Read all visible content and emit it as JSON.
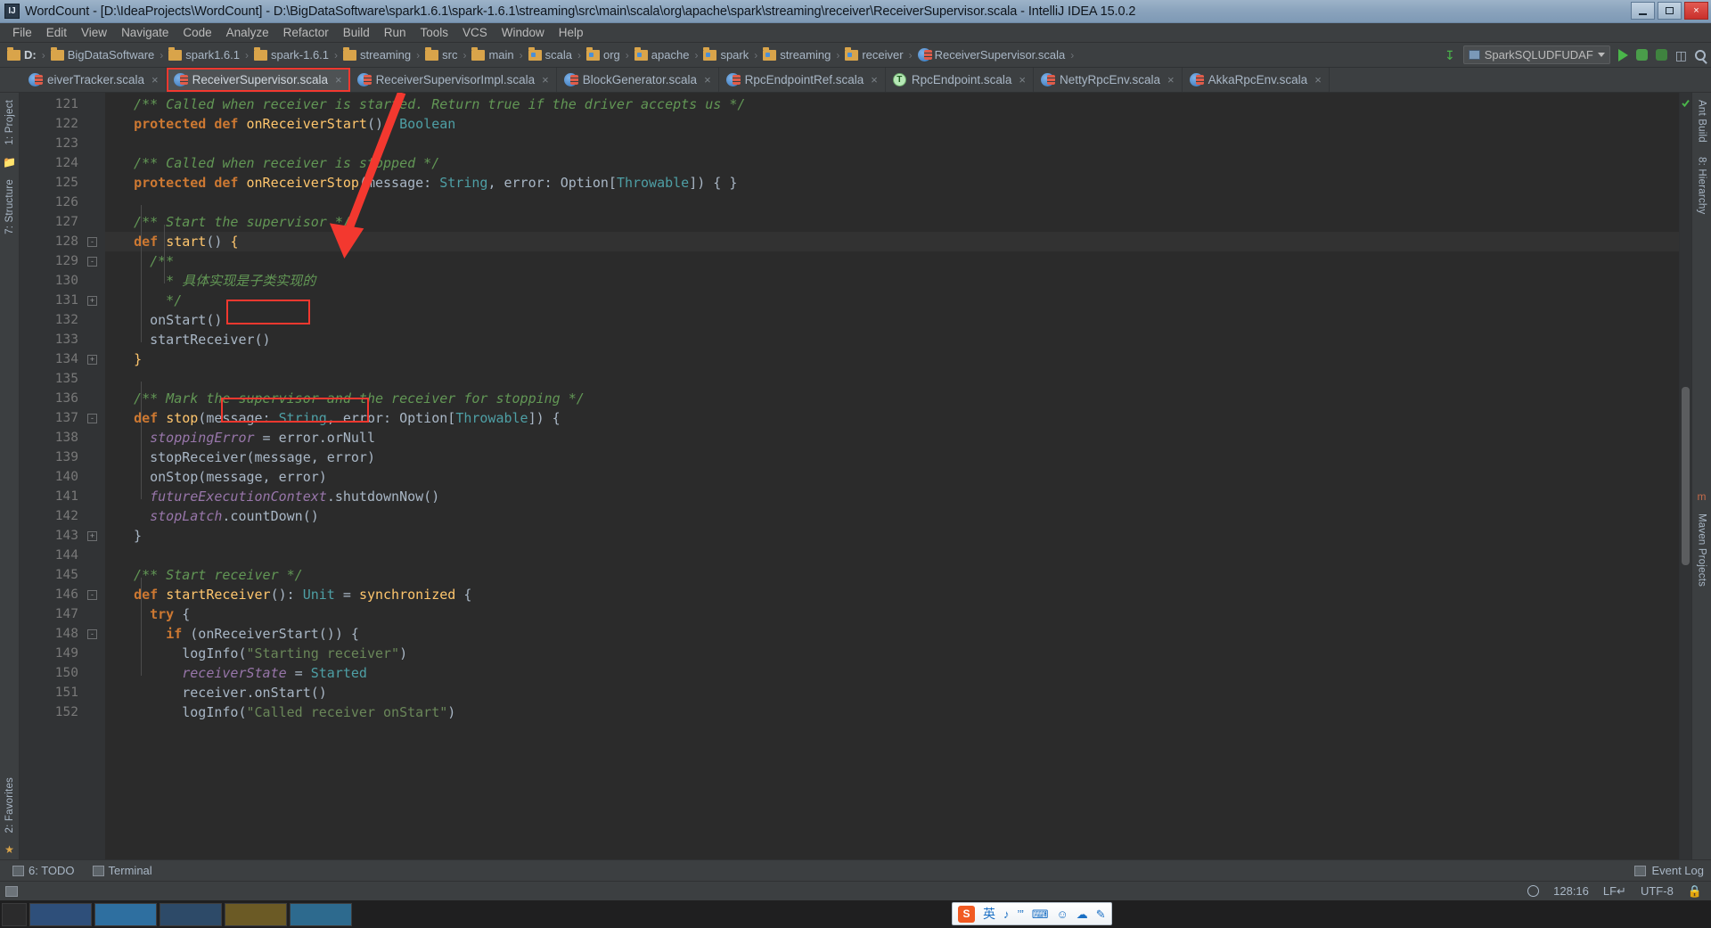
{
  "window": {
    "title": "WordCount - [D:\\IdeaProjects\\WordCount] - D:\\BigDataSoftware\\spark1.6.1\\spark-1.6.1\\streaming\\src\\main\\scala\\org\\apache\\spark\\streaming\\receiver\\ReceiverSupervisor.scala - IntelliJ IDEA 15.0.2",
    "app_icon": "IJ",
    "buttons": {
      "minimize": "minimize-icon",
      "maximize": "maximize-icon",
      "close": "×"
    }
  },
  "menubar": {
    "items": [
      "File",
      "Edit",
      "View",
      "Navigate",
      "Code",
      "Analyze",
      "Refactor",
      "Build",
      "Run",
      "Tools",
      "VCS",
      "Window",
      "Help"
    ]
  },
  "breadcrumb": {
    "items": [
      {
        "label": "D:",
        "icon": "folder-icon",
        "bold": true
      },
      {
        "label": "BigDataSoftware",
        "icon": "folder-icon",
        "bold": false
      },
      {
        "label": "spark1.6.1",
        "icon": "folder-icon",
        "bold": false
      },
      {
        "label": "spark-1.6.1",
        "icon": "folder-icon",
        "bold": false
      },
      {
        "label": "streaming",
        "icon": "folder-icon",
        "bold": false
      },
      {
        "label": "src",
        "icon": "folder-icon",
        "bold": false
      },
      {
        "label": "main",
        "icon": "folder-icon",
        "bold": false
      },
      {
        "label": "scala",
        "icon": "source-folder-icon",
        "bold": false
      },
      {
        "label": "org",
        "icon": "source-folder-icon",
        "bold": false
      },
      {
        "label": "apache",
        "icon": "source-folder-icon",
        "bold": false
      },
      {
        "label": "spark",
        "icon": "source-folder-icon",
        "bold": false
      },
      {
        "label": "streaming",
        "icon": "source-folder-icon",
        "bold": false
      },
      {
        "label": "receiver",
        "icon": "source-folder-icon",
        "bold": false
      },
      {
        "label": "ReceiverSupervisor.scala",
        "icon": "scala-file-icon",
        "bold": false
      }
    ]
  },
  "toolbar_right": {
    "sync_icon": "update-project-icon",
    "run_config": {
      "name": "SparkSQLUDFUDAF",
      "icon": "config-icon",
      "dropdown": "chevron-down-icon"
    },
    "run_icon": "run-icon",
    "debug_icon": "debug-icon",
    "coverage_icon": "run-with-coverage-icon",
    "layout_icon": "project-structure-icon",
    "search_icon": "search-everywhere-icon"
  },
  "tabs": [
    {
      "label": "eiverTracker.scala",
      "icon": "scala-file-icon",
      "active": false,
      "highlighted": false,
      "close": "×"
    },
    {
      "label": "ReceiverSupervisor.scala",
      "icon": "scala-file-icon",
      "active": true,
      "highlighted": true,
      "close": "×"
    },
    {
      "label": "ReceiverSupervisorImpl.scala",
      "icon": "scala-file-icon",
      "active": false,
      "highlighted": false,
      "close": "×"
    },
    {
      "label": "BlockGenerator.scala",
      "icon": "scala-file-icon",
      "active": false,
      "highlighted": false,
      "close": "×"
    },
    {
      "label": "RpcEndpointRef.scala",
      "icon": "scala-file-icon",
      "active": false,
      "highlighted": false,
      "close": "×"
    },
    {
      "label": "RpcEndpoint.scala",
      "icon": "scala-trait-icon",
      "active": false,
      "highlighted": false,
      "close": "×"
    },
    {
      "label": "NettyRpcEnv.scala",
      "icon": "scala-file-icon",
      "active": false,
      "highlighted": false,
      "close": "×"
    },
    {
      "label": "AkkaRpcEnv.scala",
      "icon": "scala-file-icon",
      "active": false,
      "highlighted": false,
      "close": "×"
    }
  ],
  "left_rail": {
    "project_label": "1: Project",
    "structure_label": "7: Structure",
    "favorites_label": "2: Favorites"
  },
  "right_rail": {
    "ant_label": "Ant Build",
    "hierarchy_label": "8: Hierarchy",
    "maven_label": "Maven Projects"
  },
  "editor": {
    "first_line_number": 121,
    "current_line": 128,
    "caret_position": "128:16",
    "lines": [
      {
        "n": 121,
        "tokens": [
          {
            "t": "  /** Called when receiver is started. Return true if the driver accepts us */",
            "c": "cmt"
          }
        ]
      },
      {
        "n": 122,
        "tokens": [
          {
            "t": "  ",
            "c": "pun"
          },
          {
            "t": "protected def ",
            "c": "kw"
          },
          {
            "t": "onReceiverStart",
            "c": "fn"
          },
          {
            "t": "(): ",
            "c": "pun"
          },
          {
            "t": "Boolean",
            "c": "typ"
          }
        ]
      },
      {
        "n": 123,
        "tokens": [
          {
            "t": "",
            "c": "pun"
          }
        ]
      },
      {
        "n": 124,
        "tokens": [
          {
            "t": "  /** Called when receiver is stopped */",
            "c": "cmt"
          }
        ]
      },
      {
        "n": 125,
        "tokens": [
          {
            "t": "  ",
            "c": "pun"
          },
          {
            "t": "protected def ",
            "c": "kw"
          },
          {
            "t": "onReceiverStop",
            "c": "fn"
          },
          {
            "t": "(message: ",
            "c": "pun"
          },
          {
            "t": "String",
            "c": "typ"
          },
          {
            "t": ", error: ",
            "c": "pun"
          },
          {
            "t": "Option",
            "c": "pun"
          },
          {
            "t": "[",
            "c": "pun"
          },
          {
            "t": "Throwable",
            "c": "typ"
          },
          {
            "t": "]) { }",
            "c": "pun"
          }
        ]
      },
      {
        "n": 126,
        "tokens": [
          {
            "t": "",
            "c": "pun"
          }
        ]
      },
      {
        "n": 127,
        "tokens": [
          {
            "t": "  /** Start the supervisor */",
            "c": "cmt"
          }
        ]
      },
      {
        "n": 128,
        "tokens": [
          {
            "t": "  ",
            "c": "pun"
          },
          {
            "t": "def ",
            "c": "kw"
          },
          {
            "t": "start",
            "c": "fn"
          },
          {
            "t": "() ",
            "c": "pun"
          },
          {
            "t": "{",
            "c": "brc"
          }
        ]
      },
      {
        "n": 129,
        "tokens": [
          {
            "t": "    /**",
            "c": "cmt"
          }
        ]
      },
      {
        "n": 130,
        "tokens": [
          {
            "t": "      * 具体实现是子类实现的",
            "c": "cmt"
          }
        ]
      },
      {
        "n": 131,
        "tokens": [
          {
            "t": "      */",
            "c": "cmt"
          }
        ]
      },
      {
        "n": 132,
        "tokens": [
          {
            "t": "    onStart()",
            "c": "pun"
          }
        ]
      },
      {
        "n": 133,
        "tokens": [
          {
            "t": "    startReceiver()",
            "c": "pun"
          }
        ]
      },
      {
        "n": 134,
        "tokens": [
          {
            "t": "  ",
            "c": "pun"
          },
          {
            "t": "}",
            "c": "brc"
          }
        ]
      },
      {
        "n": 135,
        "tokens": [
          {
            "t": "",
            "c": "pun"
          }
        ]
      },
      {
        "n": 136,
        "tokens": [
          {
            "t": "  /** Mark the supervisor and the receiver for stopping */",
            "c": "cmt"
          }
        ]
      },
      {
        "n": 137,
        "tokens": [
          {
            "t": "  ",
            "c": "pun"
          },
          {
            "t": "def ",
            "c": "kw"
          },
          {
            "t": "stop",
            "c": "fn"
          },
          {
            "t": "(message: ",
            "c": "pun"
          },
          {
            "t": "String",
            "c": "typ"
          },
          {
            "t": ", error: ",
            "c": "pun"
          },
          {
            "t": "Option",
            "c": "pun"
          },
          {
            "t": "[",
            "c": "pun"
          },
          {
            "t": "Throwable",
            "c": "typ"
          },
          {
            "t": "]) {",
            "c": "pun"
          }
        ]
      },
      {
        "n": 138,
        "tokens": [
          {
            "t": "    ",
            "c": "pun"
          },
          {
            "t": "stoppingError",
            "c": "fld"
          },
          {
            "t": " = error.orNull",
            "c": "pun"
          }
        ]
      },
      {
        "n": 139,
        "tokens": [
          {
            "t": "    stopReceiver(message, error)",
            "c": "pun"
          }
        ]
      },
      {
        "n": 140,
        "tokens": [
          {
            "t": "    onStop(message, error)",
            "c": "pun"
          }
        ]
      },
      {
        "n": 141,
        "tokens": [
          {
            "t": "    ",
            "c": "pun"
          },
          {
            "t": "futureExecutionContext",
            "c": "fld"
          },
          {
            "t": ".shutdownNow()",
            "c": "pun"
          }
        ]
      },
      {
        "n": 142,
        "tokens": [
          {
            "t": "    ",
            "c": "pun"
          },
          {
            "t": "stopLatch",
            "c": "fld"
          },
          {
            "t": ".countDown()",
            "c": "pun"
          }
        ]
      },
      {
        "n": 143,
        "tokens": [
          {
            "t": "  }",
            "c": "pun"
          }
        ]
      },
      {
        "n": 144,
        "tokens": [
          {
            "t": "",
            "c": "pun"
          }
        ]
      },
      {
        "n": 145,
        "tokens": [
          {
            "t": "  /** Start receiver */",
            "c": "cmt"
          }
        ]
      },
      {
        "n": 146,
        "tokens": [
          {
            "t": "  ",
            "c": "pun"
          },
          {
            "t": "def ",
            "c": "kw"
          },
          {
            "t": "startReceiver",
            "c": "fn"
          },
          {
            "t": "(): ",
            "c": "pun"
          },
          {
            "t": "Unit",
            "c": "typ"
          },
          {
            "t": " = ",
            "c": "pun"
          },
          {
            "t": "synchronized",
            "c": "fn"
          },
          {
            "t": " {",
            "c": "pun"
          }
        ]
      },
      {
        "n": 147,
        "tokens": [
          {
            "t": "    ",
            "c": "pun"
          },
          {
            "t": "try",
            "c": "kw"
          },
          {
            "t": " {",
            "c": "pun"
          }
        ]
      },
      {
        "n": 148,
        "tokens": [
          {
            "t": "      ",
            "c": "pun"
          },
          {
            "t": "if",
            "c": "kw"
          },
          {
            "t": " (onReceiverStart()) {",
            "c": "pun"
          }
        ]
      },
      {
        "n": 149,
        "tokens": [
          {
            "t": "        logInfo(",
            "c": "pun"
          },
          {
            "t": "\"Starting receiver\"",
            "c": "str"
          },
          {
            "t": ")",
            "c": "pun"
          }
        ]
      },
      {
        "n": 150,
        "tokens": [
          {
            "t": "        ",
            "c": "pun"
          },
          {
            "t": "receiverState",
            "c": "fld"
          },
          {
            "t": " = ",
            "c": "pun"
          },
          {
            "t": "Started",
            "c": "typ"
          }
        ]
      },
      {
        "n": 151,
        "tokens": [
          {
            "t": "        receiver.onStart()",
            "c": "pun"
          }
        ]
      },
      {
        "n": 152,
        "tokens": [
          {
            "t": "        logInfo(",
            "c": "pun"
          },
          {
            "t": "\"Called receiver onStart\"",
            "c": "str"
          },
          {
            "t": ")",
            "c": "pun"
          }
        ]
      }
    ],
    "annotations": [
      {
        "name": "start-method-highlight",
        "label": "start()"
      },
      {
        "name": "start-receiver-call-highlight",
        "label": "startReceiver()"
      },
      {
        "name": "tab-highlight",
        "label": "ReceiverSupervisor.scala"
      },
      {
        "name": "pointer-arrow",
        "label": "arrow pointing to start()"
      }
    ]
  },
  "bottom_strip": {
    "todo_label": "6: TODO",
    "terminal_label": "Terminal",
    "event_log_label": "Event Log"
  },
  "statusbar": {
    "caret": "128:16",
    "line_separator": "LF↵",
    "encoding": "UTF-8",
    "lock_icon": "lock-icon",
    "clock_icon": "clock-icon"
  },
  "taskbar": {
    "start_icon": "start-button",
    "ime": {
      "logo": "S",
      "language": "英",
      "glyphs": [
        "♪",
        "’”",
        "⌨",
        "☺",
        "☁",
        "✎"
      ]
    }
  },
  "colors": {
    "accent_red": "#f3382f",
    "editor_bg": "#2b2b2b",
    "gutter_bg": "#313335",
    "chrome_bg": "#3c3f41",
    "keyword": "#cc7832",
    "comment": "#629755",
    "string": "#6a8759",
    "function": "#ffc66d",
    "type": "#4e9fa5",
    "field": "#9876aa",
    "text": "#a9b7c6"
  }
}
